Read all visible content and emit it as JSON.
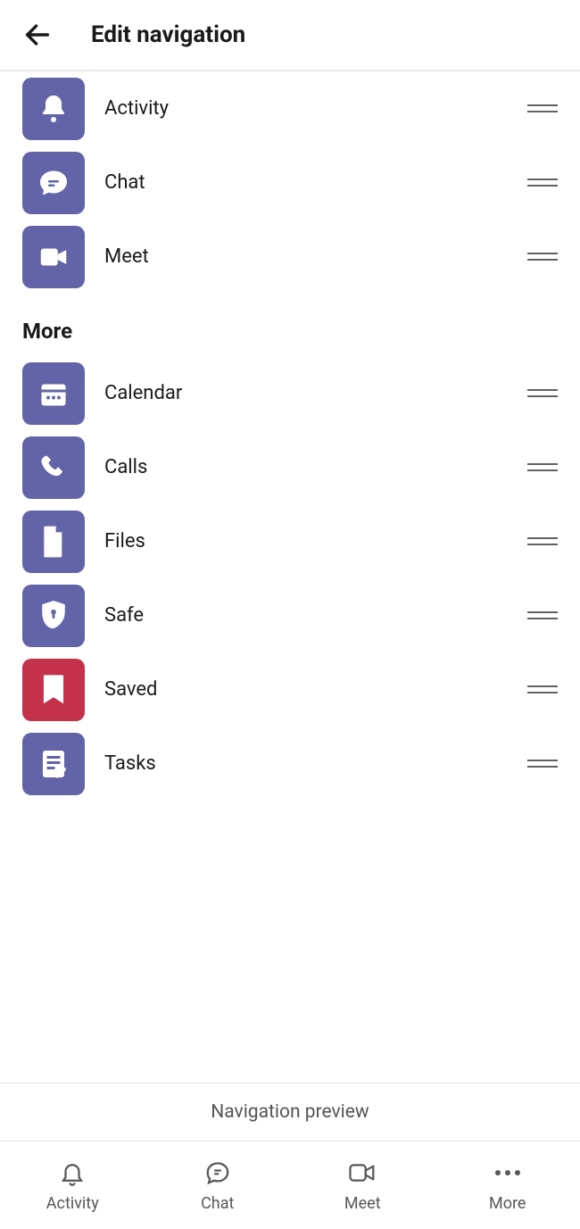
{
  "header": {
    "title": "Edit navigation"
  },
  "sections": {
    "primary": [
      {
        "id": "activity",
        "label": "Activity",
        "icon": "bell",
        "tile": "purple"
      },
      {
        "id": "chat",
        "label": "Chat",
        "icon": "chat",
        "tile": "purple"
      },
      {
        "id": "meet",
        "label": "Meet",
        "icon": "video",
        "tile": "purple"
      }
    ],
    "more_label": "More",
    "more": [
      {
        "id": "calendar",
        "label": "Calendar",
        "icon": "calendar",
        "tile": "purple"
      },
      {
        "id": "calls",
        "label": "Calls",
        "icon": "phone",
        "tile": "purple"
      },
      {
        "id": "files",
        "label": "Files",
        "icon": "file",
        "tile": "purple"
      },
      {
        "id": "safe",
        "label": "Safe",
        "icon": "shield",
        "tile": "purple"
      },
      {
        "id": "saved",
        "label": "Saved",
        "icon": "bookmark",
        "tile": "pink"
      },
      {
        "id": "tasks",
        "label": "Tasks",
        "icon": "tasks",
        "tile": "purple"
      }
    ]
  },
  "preview_label": "Navigation preview",
  "bottom_nav": [
    {
      "id": "activity",
      "label": "Activity",
      "icon": "bell-outline"
    },
    {
      "id": "chat",
      "label": "Chat",
      "icon": "chat-outline"
    },
    {
      "id": "meet",
      "label": "Meet",
      "icon": "video-outline"
    },
    {
      "id": "more",
      "label": "More",
      "icon": "dots"
    }
  ],
  "colors": {
    "purple": "#6264a7",
    "pink": "#c4314b"
  }
}
